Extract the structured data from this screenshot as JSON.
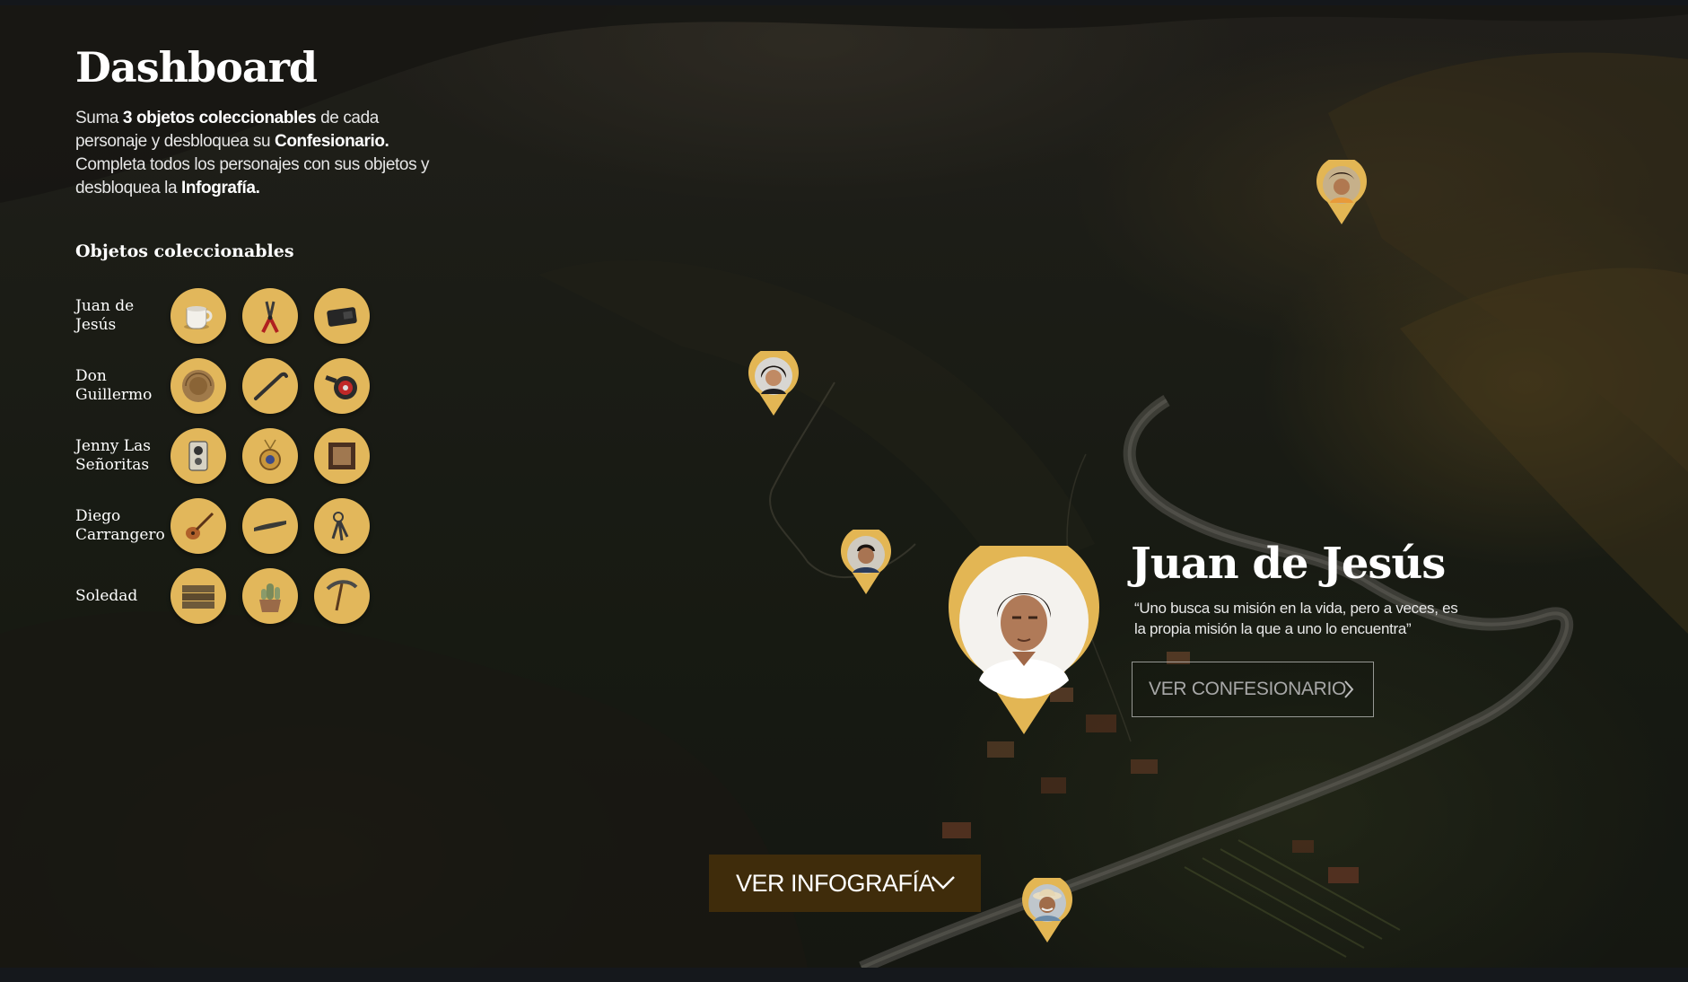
{
  "dashboard": {
    "title": "Dashboard",
    "intro": {
      "p1": "Suma ",
      "b1": "3 objetos coleccionables",
      "p2": " de cada personaje y desbloquea su ",
      "b2": "Confesionario.",
      "p3": " Completa todos los personajes con sus objetos y desbloquea la ",
      "b3": "Infografía."
    },
    "collectibles_heading": "Objetos coleccionables"
  },
  "characters": [
    {
      "name": "Juan de Jesús",
      "objects": [
        "cup-icon",
        "pruning-shears-icon",
        "wallet-icon"
      ]
    },
    {
      "name": "Don Guillermo",
      "objects": [
        "hat-icon",
        "crowbar-icon",
        "fishing-reel-icon"
      ]
    },
    {
      "name": "Jenny Las Señoritas",
      "objects": [
        "camera-icon",
        "medallion-icon",
        "picture-frame-icon"
      ]
    },
    {
      "name": "Diego Carrangero",
      "objects": [
        "guitar-icon",
        "machete-icon",
        "keys-icon"
      ]
    },
    {
      "name": "Soledad",
      "objects": [
        "wood-planks-icon",
        "cactus-pot-icon",
        "pickaxe-icon"
      ]
    }
  ],
  "featured": {
    "name": "Juan de Jesús",
    "quote": "“Uno busca su misión en la vida, pero a veces, es la propia misión la que a uno lo encuentra”",
    "button_label": "VER CONFESIONARIO"
  },
  "map_pins": [
    {
      "character": "Soledad",
      "icon": "woman-avatar-icon"
    },
    {
      "character": "Jenny Las Señoritas",
      "icon": "woman-avatar-icon"
    },
    {
      "character": "Diego Carrangero",
      "icon": "man-avatar-icon"
    },
    {
      "character": "Juan de Jesús",
      "icon": "man-avatar-icon"
    },
    {
      "character": "Don Guillermo",
      "icon": "man-hat-avatar-icon"
    }
  ],
  "infographic_button": {
    "label": "VER INFOGRAFÍA",
    "icon": "chevron-down-icon"
  },
  "colors": {
    "accent_gold": "#e2b75b",
    "pin_gold": "#e3b654",
    "infographic_button_bg": "#3f2c0b",
    "text": "#ffffff"
  }
}
